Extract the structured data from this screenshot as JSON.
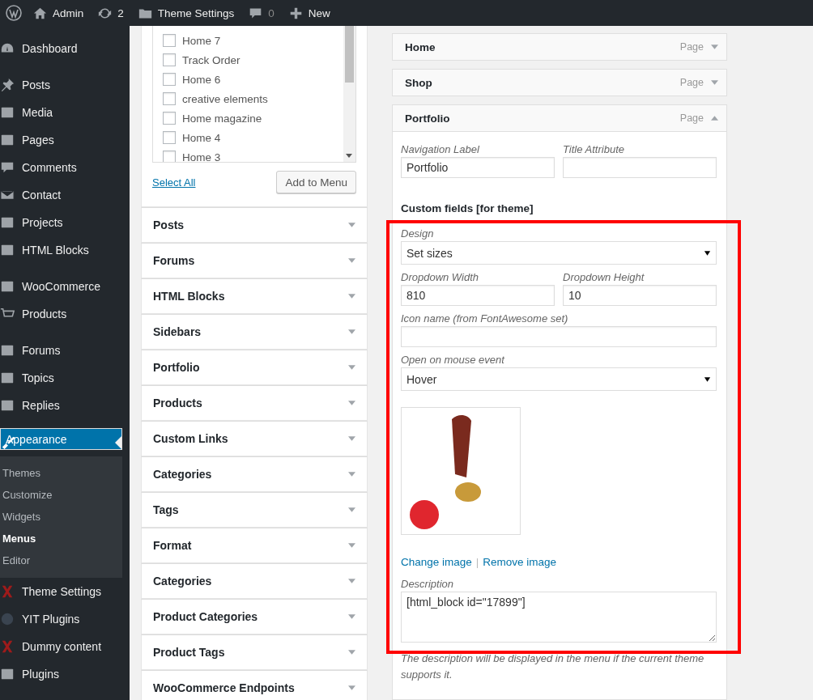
{
  "admin_bar": {
    "items": [
      {
        "kind": "home",
        "label": "Admin",
        "disabled": false
      },
      {
        "kind": "updates",
        "label": "2",
        "disabled": false
      },
      {
        "kind": "folder",
        "label": "Theme Settings",
        "disabled": false
      },
      {
        "kind": "comments",
        "label": "0",
        "disabled": true
      },
      {
        "kind": "new",
        "label": "New",
        "disabled": false
      }
    ]
  },
  "sidebar": {
    "groups": [
      {
        "items": [
          {
            "label": "Dashboard",
            "selected": false
          }
        ]
      },
      {
        "items": [
          {
            "label": "Posts",
            "selected": false
          },
          {
            "label": "Media",
            "selected": false
          },
          {
            "label": "Pages",
            "selected": false
          },
          {
            "label": "Comments",
            "selected": false
          },
          {
            "label": "Contact",
            "selected": false
          },
          {
            "label": "Projects",
            "selected": false
          },
          {
            "label": "HTML Blocks",
            "selected": false
          }
        ]
      },
      {
        "items": [
          {
            "label": "WooCommerce",
            "selected": false
          },
          {
            "label": "Products",
            "selected": false
          }
        ]
      },
      {
        "items": [
          {
            "label": "Forums",
            "selected": false
          },
          {
            "label": "Topics",
            "selected": false
          },
          {
            "label": "Replies",
            "selected": false
          }
        ]
      },
      {
        "items": [
          {
            "label": "Appearance",
            "selected": true,
            "children": [
              {
                "label": "Themes",
                "selected": false
              },
              {
                "label": "Customize",
                "selected": false
              },
              {
                "label": "Widgets",
                "selected": false
              },
              {
                "label": "Menus",
                "selected": true
              },
              {
                "label": "Editor",
                "selected": false
              }
            ]
          },
          {
            "label": "Theme Settings",
            "selected": false
          },
          {
            "label": "YIT Plugins",
            "selected": false
          },
          {
            "label": "Dummy content",
            "selected": false
          },
          {
            "label": "Plugins",
            "selected": false
          }
        ]
      }
    ]
  },
  "pages_box": {
    "items": [
      {
        "label": "Home 7",
        "checked": false
      },
      {
        "label": "Track Order",
        "checked": false
      },
      {
        "label": "Home 6",
        "checked": false
      },
      {
        "label": "creative elements",
        "checked": false
      },
      {
        "label": "Home magazine",
        "checked": false
      },
      {
        "label": "Home 4",
        "checked": false
      },
      {
        "label": "Home 3",
        "checked": false
      }
    ],
    "select_all": "Select All",
    "add_button": "Add to Menu"
  },
  "sections": [
    "Posts",
    "Forums",
    "HTML Blocks",
    "Sidebars",
    "Portfolio",
    "Products",
    "Custom Links",
    "Categories",
    "Tags",
    "Format",
    "Categories",
    "Product Categories",
    "Product Tags",
    "WooCommerce Endpoints"
  ],
  "menu_items": [
    {
      "title": "Home",
      "type": "Page",
      "expanded": false
    },
    {
      "title": "Shop",
      "type": "Page",
      "expanded": false
    },
    {
      "title": "Portfolio",
      "type": "Page",
      "expanded": true
    }
  ],
  "item_settings": {
    "navigation_label": {
      "label": "Navigation Label",
      "value": "Portfolio"
    },
    "title_attribute": {
      "label": "Title Attribute"
    },
    "custom_heading": "Custom fields [for theme]",
    "design": {
      "label": "Design",
      "value": "Set sizes"
    },
    "dropdown_width": {
      "label": "Dropdown Width",
      "value": "810"
    },
    "dropdown_height": {
      "label": "Dropdown Height",
      "value": "10"
    },
    "icon_name": {
      "label": "Icon name (from FontAwesome set)"
    },
    "mouse_event": {
      "label": "Open on mouse event",
      "value": "Hover"
    },
    "change_image": "Change image",
    "separator": "|",
    "remove_image": "Remove image",
    "description": {
      "label": "Description",
      "value": "[html_block id=\"17899\"]"
    },
    "description_hint": "The description will be displayed in the menu if the current theme supports it."
  }
}
